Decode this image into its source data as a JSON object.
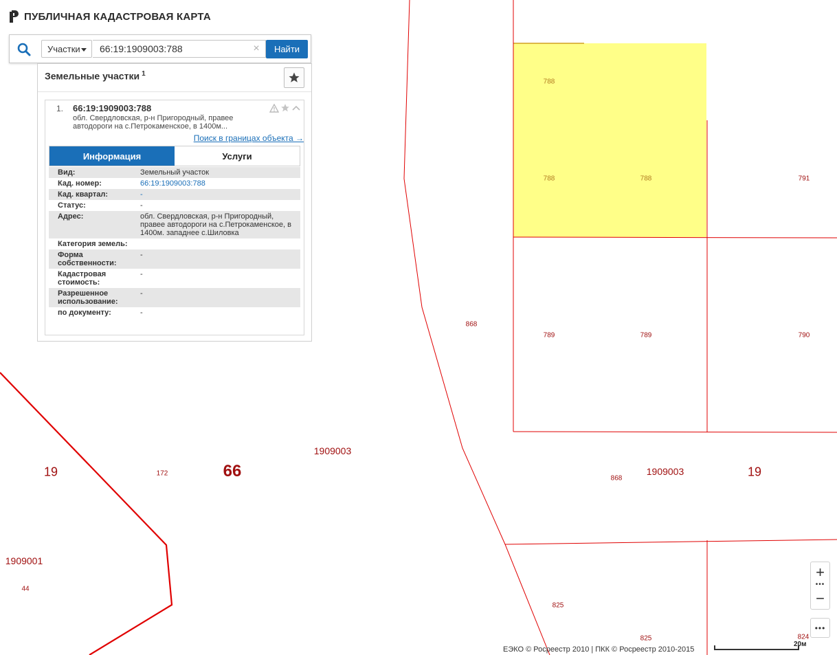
{
  "header": {
    "title": "ПУБЛИЧНАЯ КАДАСТРОВАЯ КАРТА"
  },
  "search": {
    "type_selected": "Участки",
    "query": "66:19:1909003:788",
    "button_label": "Найти",
    "clear_glyph": "×"
  },
  "results_panel": {
    "title": "Земельные участки",
    "count": "1",
    "result": {
      "index": "1.",
      "cadastral_number": "66:19:1909003:788",
      "address_short": "обл. Свердловская, р-н Пригородный, правее автодороги на с.Петрокаменское, в 1400м...",
      "search_in_bounds_link": "Поиск в границах объекта →",
      "tabs": [
        {
          "label": "Информация",
          "active": true
        },
        {
          "label": "Услуги",
          "active": false
        }
      ],
      "info_rows": [
        {
          "key": "Вид:",
          "value": "Земельный участок"
        },
        {
          "key": "Кад. номер:",
          "value": "66:19:1909003:788"
        },
        {
          "key": "Кад. квартал:",
          "value": "-"
        },
        {
          "key": "Статус:",
          "value": "-"
        },
        {
          "key": "Адрес:",
          "value": "обл. Свердловская, р-н Пригородный, правее автодороги на с.Петрокаменское, в 1400м. западнее с.Шиловка"
        },
        {
          "key": "Категория земель:",
          "value": ""
        },
        {
          "key": "Форма собственности:",
          "value": "-"
        },
        {
          "key": "Кадастровая стоимость:",
          "value": "-"
        },
        {
          "key": "Разрешенное использование:",
          "value": "-"
        },
        {
          "key": "по документу:",
          "value": "-"
        }
      ]
    }
  },
  "map": {
    "selected_fill": "#ffff88",
    "boundary_color": "#e00000",
    "label_color": "#a01010",
    "labels": {
      "p788a": "788",
      "p788b": "788",
      "p788c": "788",
      "p791": "791",
      "p868a": "868",
      "p789a": "789",
      "p789b": "789",
      "p790": "790",
      "q1909003a": "1909003",
      "r19a": "19",
      "p172": "172",
      "r66": "66",
      "p868b": "868",
      "q1909003b": "1909003",
      "r19b": "19",
      "q1909001": "1909001",
      "p44": "44",
      "p825a": "825",
      "p825b": "825",
      "p824": "824"
    }
  },
  "controls": {
    "zoom_in": "+",
    "zoom_out": "−",
    "zoom_dots": "•••",
    "more_dots": "•••"
  },
  "footer": {
    "attribution": "ЕЭКО © Росреестр 2010 | ПКК © Росреестр 2010-2015",
    "scale_label": "20м"
  }
}
